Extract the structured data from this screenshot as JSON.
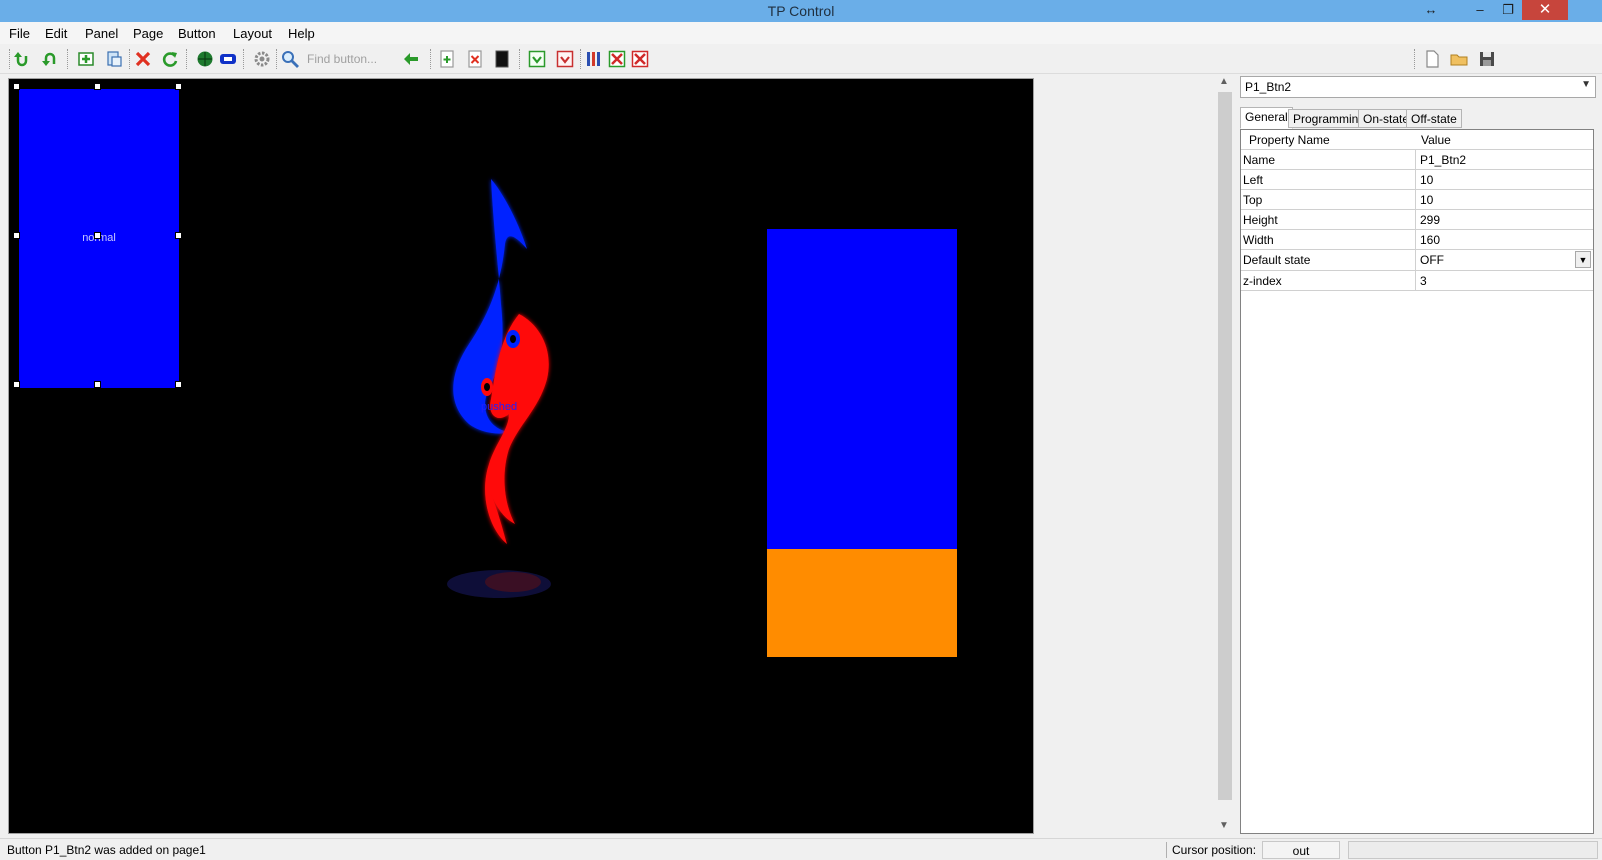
{
  "window": {
    "title": "TP Control",
    "resize_glyph": "↔",
    "minimize_glyph": "–",
    "restore_glyph": "❐",
    "close_glyph": "✕"
  },
  "menu": [
    "File",
    "Edit",
    "Panel",
    "Page",
    "Button",
    "Layout",
    "Help"
  ],
  "toolbar": {
    "find_placeholder": "Find button...",
    "icons": [
      "undo-icon",
      "redo-icon",
      "add-panel-icon",
      "page-icon",
      "delete-icon",
      "refresh-icon",
      "globe-icon",
      "screen-icon",
      "settings-icon",
      "search-icon",
      "go-back-icon",
      "add-page-icon",
      "delete-page-icon",
      "black-page-icon",
      "download-icon",
      "download-red-icon",
      "columns-icon",
      "close-box-icon",
      "close-red-icon",
      "new-file-icon",
      "open-folder-icon",
      "save-icon"
    ]
  },
  "canvas": {
    "background": "#000000",
    "normal_button": {
      "label": "normal",
      "color": "#0000ff"
    },
    "pushed_label": "pushed",
    "blue_rect_color": "#0000ff",
    "orange_rect_color": "#ff8c00"
  },
  "properties": {
    "object_selected": "P1_Btn2",
    "tabs": [
      "General",
      "Programming",
      "On-state",
      "Off-state"
    ],
    "active_tab": "General",
    "header": {
      "name": "Property Name",
      "value": "Value"
    },
    "rows": [
      {
        "name": "Name",
        "value": "P1_Btn2"
      },
      {
        "name": "Left",
        "value": "10"
      },
      {
        "name": "Top",
        "value": "10"
      },
      {
        "name": "Height",
        "value": "299"
      },
      {
        "name": "Width",
        "value": "160"
      },
      {
        "name": "Default state",
        "value": "OFF"
      },
      {
        "name": "z-index",
        "value": "3"
      }
    ]
  },
  "status": {
    "message": "Button P1_Btn2 was added on page1",
    "cursor_label": "Cursor position:",
    "cursor_value": "out"
  }
}
